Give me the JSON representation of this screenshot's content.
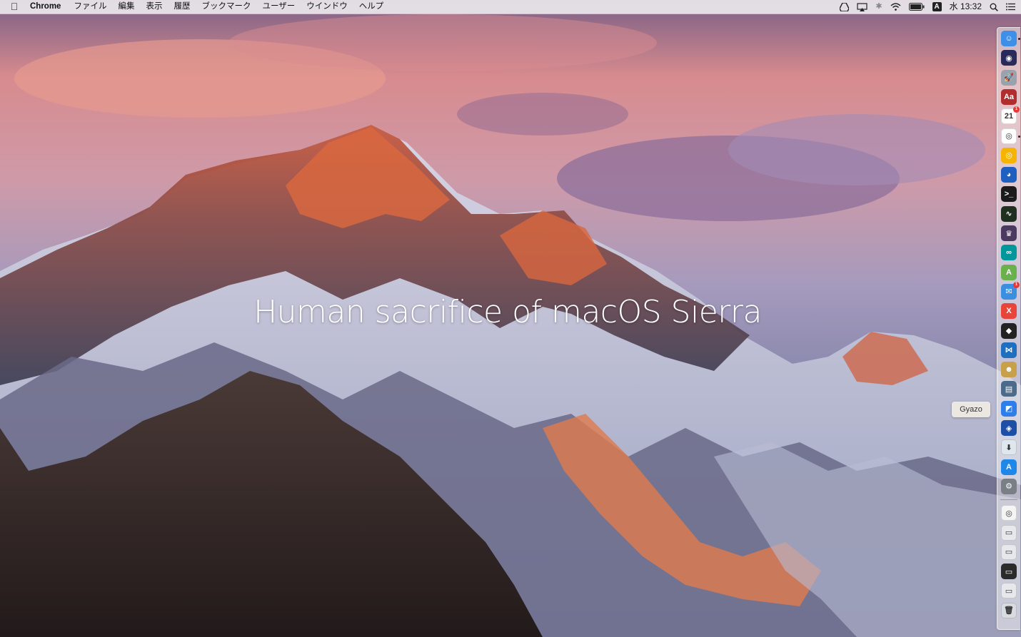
{
  "menubar": {
    "apple_icon": "apple-icon",
    "app_name": "Chrome",
    "menus": [
      "ファイル",
      "編集",
      "表示",
      "履歴",
      "ブックマーク",
      "ユーザー",
      "ウインドウ",
      "ヘルプ"
    ],
    "status": {
      "input_source": "A",
      "clock": "水 13:32"
    }
  },
  "desktop": {
    "headline": "Human sacrifice of macOS Sierra"
  },
  "dock": {
    "tooltip": "Gyazo",
    "apps": [
      {
        "name": "finder-icon",
        "color": "#3d8fe8",
        "glyph": "☺",
        "running": true
      },
      {
        "name": "siri-icon",
        "color": "#2a2a5a",
        "glyph": "◉",
        "running": false
      },
      {
        "name": "launchpad-icon",
        "color": "#9aa3ad",
        "glyph": "🚀",
        "running": false
      },
      {
        "name": "dictionary-icon",
        "color": "#b22d2d",
        "glyph": "Aa",
        "running": false
      },
      {
        "name": "calendar-icon",
        "color": "#ffffff",
        "glyph": "21",
        "running": false,
        "badge": "1"
      },
      {
        "name": "chrome-icon",
        "color": "#ffffff",
        "glyph": "◎",
        "running": true
      },
      {
        "name": "chrome-canary-icon",
        "color": "#f4b400",
        "glyph": "◎",
        "running": false
      },
      {
        "name": "firefox-icon",
        "color": "#1f5fbf",
        "glyph": "◕",
        "running": false
      },
      {
        "name": "terminal-icon",
        "color": "#1b1b1b",
        "glyph": ">_",
        "running": false
      },
      {
        "name": "activity-monitor-icon",
        "color": "#203020",
        "glyph": "∿",
        "running": false
      },
      {
        "name": "alfred-icon",
        "color": "#4a3a60",
        "glyph": "♛",
        "running": false
      },
      {
        "name": "arduino-icon",
        "color": "#00979c",
        "glyph": "∞",
        "running": false
      },
      {
        "name": "android-studio-icon",
        "color": "#6ab04c",
        "glyph": "A",
        "running": false
      },
      {
        "name": "mail-icon",
        "color": "#3b8fe0",
        "glyph": "✉",
        "running": false,
        "badge": "1"
      },
      {
        "name": "xmind-icon",
        "color": "#e8443a",
        "glyph": "X",
        "running": false
      },
      {
        "name": "unity-icon",
        "color": "#222222",
        "glyph": "◆",
        "running": false
      },
      {
        "name": "vscode-icon",
        "color": "#1e6fc0",
        "glyph": "⋈",
        "running": false
      },
      {
        "name": "cyberduck-icon",
        "color": "#c9a04a",
        "glyph": "☻",
        "running": false
      },
      {
        "name": "archive-icon",
        "color": "#4c6a8a",
        "glyph": "▤",
        "running": false
      },
      {
        "name": "gyazo-icon",
        "color": "#2f7de8",
        "glyph": "◩",
        "running": false
      },
      {
        "name": "sourcetree-icon",
        "color": "#1d4fa6",
        "glyph": "◈",
        "running": false
      },
      {
        "name": "downloads-app-icon",
        "color": "#dfe6ee",
        "glyph": "⬇",
        "running": false
      },
      {
        "name": "app-store-icon",
        "color": "#1f87e8",
        "glyph": "A",
        "running": false
      },
      {
        "name": "system-preferences-icon",
        "color": "#7a7f86",
        "glyph": "⚙",
        "running": false
      }
    ],
    "stacks": [
      {
        "name": "chrome-doc-icon",
        "color": "#f4f4f4",
        "glyph": "◎"
      },
      {
        "name": "screenshot-stack-1-icon",
        "color": "#e6e8ec",
        "glyph": "▭"
      },
      {
        "name": "screenshot-stack-2-icon",
        "color": "#e6e8ec",
        "glyph": "▭"
      },
      {
        "name": "screenshot-stack-3-icon",
        "color": "#2b2b2b",
        "glyph": "▭"
      },
      {
        "name": "screenshot-stack-4-icon",
        "color": "#e6e8ec",
        "glyph": "▭"
      },
      {
        "name": "trash-icon",
        "color": "#d8dce0",
        "glyph": "🗑"
      }
    ]
  }
}
